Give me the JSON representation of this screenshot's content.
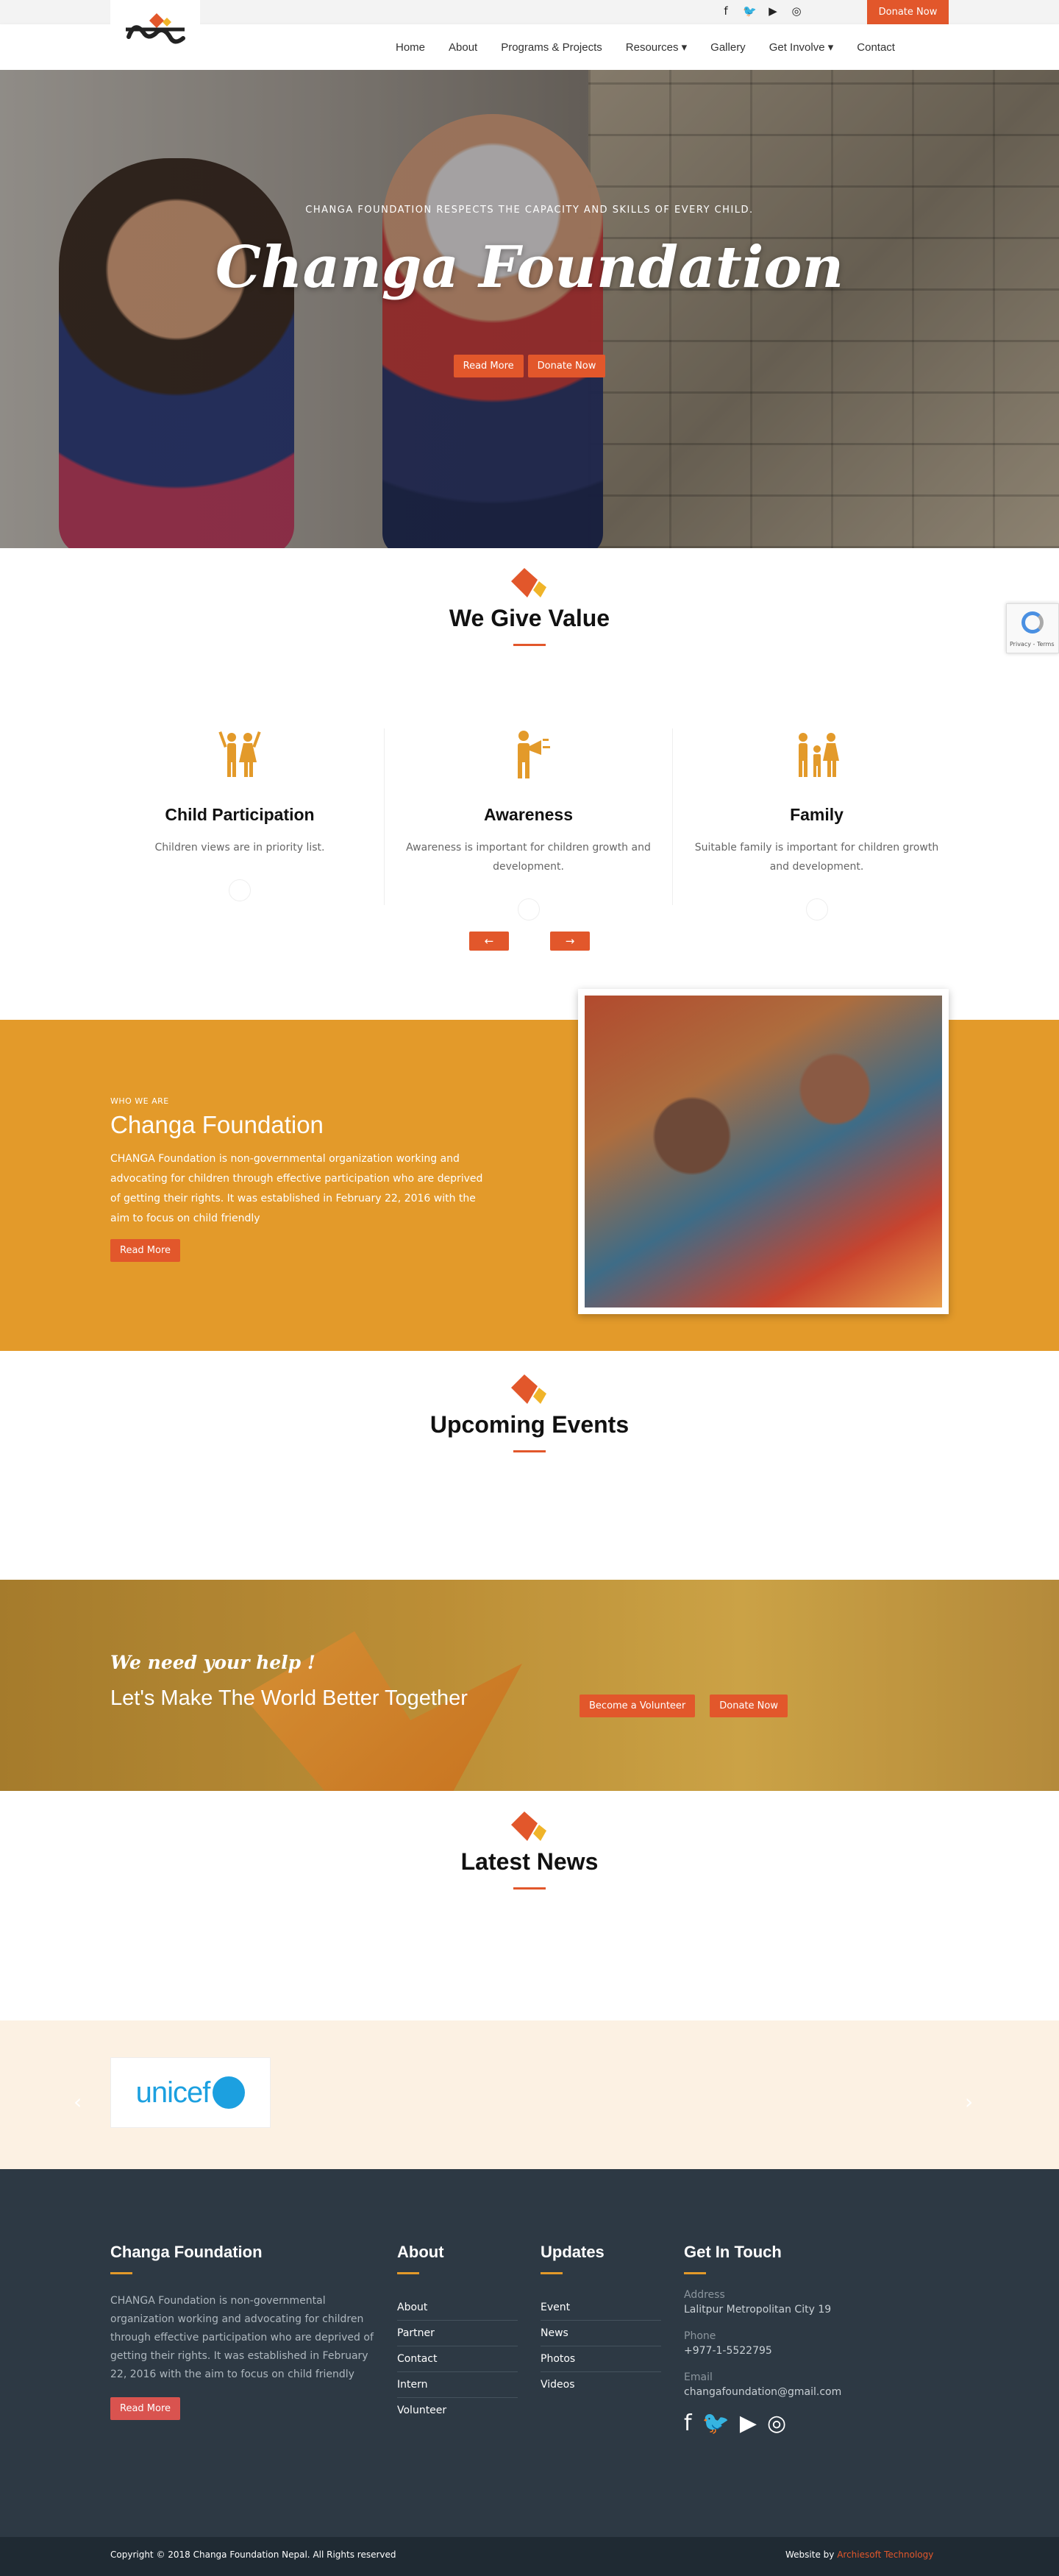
{
  "topbar": {
    "social": [
      {
        "icon": "facebook-icon",
        "glyph": "f"
      },
      {
        "icon": "twitter-icon",
        "glyph": "🐦"
      },
      {
        "icon": "youtube-icon",
        "glyph": "▶"
      },
      {
        "icon": "instagram-icon",
        "glyph": "◎"
      }
    ],
    "donate_label": "Donate Now"
  },
  "nav": {
    "items": [
      "Home",
      "About",
      "Programs & Projects",
      "Resources ▾",
      "Gallery",
      "Get Involve ▾",
      "Contact"
    ]
  },
  "hero": {
    "tagline": "CHANGA FOUNDATION RESPECTS THE CAPACITY AND SKILLS OF EVERY CHILD.",
    "title": "Changa Foundation",
    "read_more": "Read More",
    "donate": "Donate Now"
  },
  "recaptcha": {
    "text": "Privacy - Terms"
  },
  "values": {
    "title": "We Give Value",
    "cards": [
      {
        "icon": "children-icon",
        "title": "Child Participation",
        "text": "Children views are in priority list."
      },
      {
        "icon": "megaphone-icon",
        "title": "Awareness",
        "text": "Awareness is important for children growth and development."
      },
      {
        "icon": "family-icon",
        "title": "Family",
        "text": "Suitable family is important for children growth and development."
      }
    ],
    "prev": "←",
    "next": "→"
  },
  "about": {
    "small": "WHO WE ARE",
    "title": "Changa Foundation",
    "text": "CHANGA Foundation is non-governmental organization working and advocating for children through effective participation who are deprived of getting their rights. It was established in February 22, 2016 with the aim to focus on child friendly",
    "button": "Read More"
  },
  "events": {
    "title": "Upcoming Events"
  },
  "help": {
    "small": "We need your help !",
    "big": "Let's Make The World Better Together",
    "volunteer": "Become a Volunteer",
    "donate": "Donate Now"
  },
  "news": {
    "title": "Latest News"
  },
  "partners": {
    "logo_text": "unicef",
    "prev": "‹",
    "next": "›"
  },
  "footer": {
    "about_title": "Changa Foundation",
    "about_text": "CHANGA Foundation is non-governmental organization working and advocating for children through effective participation who are deprived of getting their rights. It was established in February 22, 2016 with the aim to focus on child friendly",
    "about_button": "Read More",
    "links_title": "About",
    "links": [
      "About",
      "Partner",
      "Contact",
      "Intern",
      "Volunteer"
    ],
    "updates_title": "Updates",
    "updates": [
      "Event",
      "News",
      "Photos",
      "Videos"
    ],
    "contact_title": "Get In Touch",
    "address_label": "Address",
    "address": "Lalitpur Metropolitan City 19",
    "phone_label": "Phone",
    "phone": "+977-1-5522795",
    "email_label": "Email",
    "email": "changafoundation@gmail.com",
    "social": [
      {
        "icon": "facebook-icon",
        "glyph": "f"
      },
      {
        "icon": "twitter-icon",
        "glyph": "🐦"
      },
      {
        "icon": "youtube-icon",
        "glyph": "▶"
      },
      {
        "icon": "instagram-icon",
        "glyph": "◎"
      }
    ]
  },
  "bottom": {
    "copyright": "Copyright © 2018 Changa Foundation Nepal. All Rights reserved",
    "credit_prefix": "Website by ",
    "credit_link": "Archiesoft Technology"
  },
  "colors": {
    "accent": "#e2572b",
    "gold": "#e39a2a",
    "footer": "#2d3944"
  }
}
